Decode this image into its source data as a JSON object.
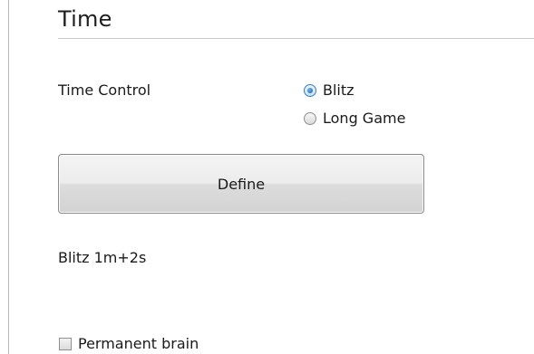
{
  "section": {
    "title": "Time"
  },
  "time_control": {
    "label": "Time Control",
    "options": [
      {
        "label": "Blitz",
        "checked": true
      },
      {
        "label": "Long Game",
        "checked": false
      }
    ]
  },
  "define_button": {
    "label": "Define"
  },
  "summary": {
    "text": "Blitz 1m+2s"
  },
  "permanent_brain": {
    "label": "Permanent brain",
    "checked": false
  },
  "colors": {
    "radio_accent": "#3c7fb1",
    "border": "#8b8b8b"
  }
}
